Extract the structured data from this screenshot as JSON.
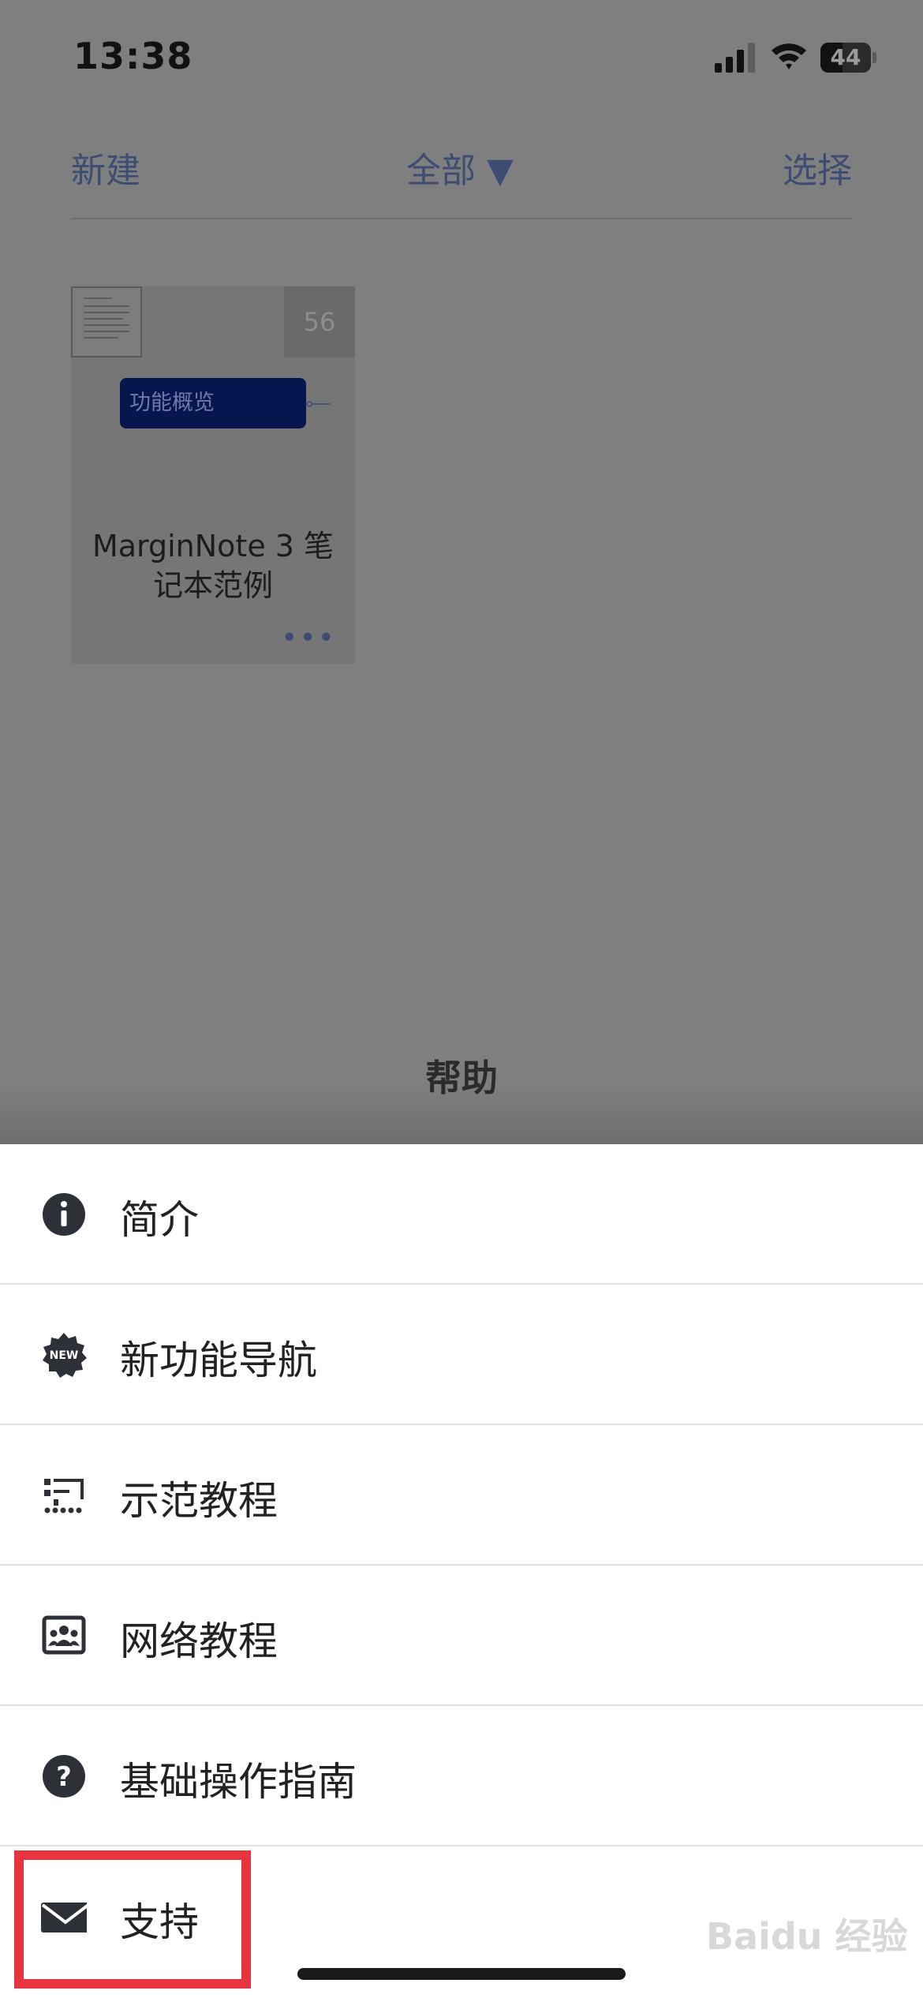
{
  "status_bar": {
    "time": "13:38",
    "battery": "44"
  },
  "nav": {
    "new_label": "新建",
    "filter_label": "全部 ▼",
    "select_label": "选择"
  },
  "notebook": {
    "page_count": "56",
    "node_text": "功能概览",
    "title_line1": "MarginNote 3 笔",
    "title_line2": "记本范例",
    "more": "•••"
  },
  "sheet": {
    "title": "帮助",
    "items": [
      {
        "label": "简介",
        "icon": "info-icon"
      },
      {
        "label": "新功能导航",
        "icon": "new-badge-icon"
      },
      {
        "label": "示范教程",
        "icon": "demo-tutorial-icon"
      },
      {
        "label": "网络教程",
        "icon": "online-tutorial-icon"
      },
      {
        "label": "基础操作指南",
        "icon": "help-question-icon"
      },
      {
        "label": "支持",
        "icon": "mail-icon"
      }
    ]
  },
  "watermark": "Baidu 经验",
  "colors": {
    "accent": "#3c4c72",
    "highlight": "#e8343e",
    "node": "#07164f"
  }
}
